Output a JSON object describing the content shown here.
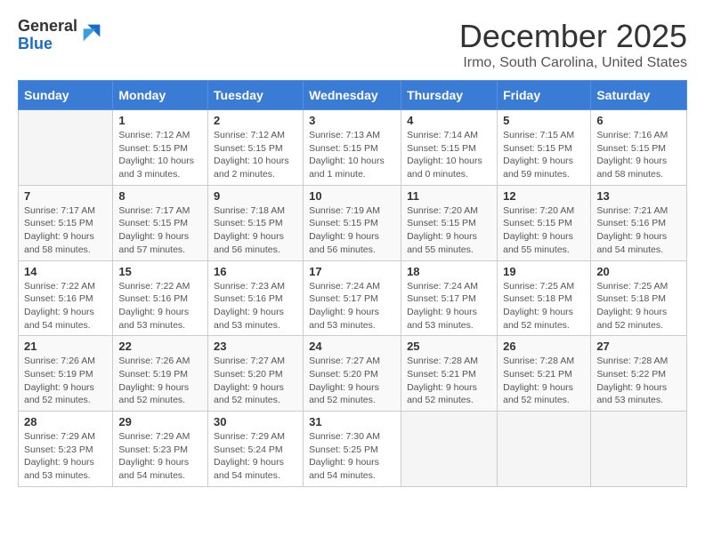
{
  "logo": {
    "general": "General",
    "blue": "Blue"
  },
  "title": "December 2025",
  "subtitle": "Irmo, South Carolina, United States",
  "headers": [
    "Sunday",
    "Monday",
    "Tuesday",
    "Wednesday",
    "Thursday",
    "Friday",
    "Saturday"
  ],
  "weeks": [
    [
      {
        "day": "",
        "info": ""
      },
      {
        "day": "1",
        "info": "Sunrise: 7:12 AM\nSunset: 5:15 PM\nDaylight: 10 hours\nand 3 minutes."
      },
      {
        "day": "2",
        "info": "Sunrise: 7:12 AM\nSunset: 5:15 PM\nDaylight: 10 hours\nand 2 minutes."
      },
      {
        "day": "3",
        "info": "Sunrise: 7:13 AM\nSunset: 5:15 PM\nDaylight: 10 hours\nand 1 minute."
      },
      {
        "day": "4",
        "info": "Sunrise: 7:14 AM\nSunset: 5:15 PM\nDaylight: 10 hours\nand 0 minutes."
      },
      {
        "day": "5",
        "info": "Sunrise: 7:15 AM\nSunset: 5:15 PM\nDaylight: 9 hours\nand 59 minutes."
      },
      {
        "day": "6",
        "info": "Sunrise: 7:16 AM\nSunset: 5:15 PM\nDaylight: 9 hours\nand 58 minutes."
      }
    ],
    [
      {
        "day": "7",
        "info": "Sunrise: 7:17 AM\nSunset: 5:15 PM\nDaylight: 9 hours\nand 58 minutes."
      },
      {
        "day": "8",
        "info": "Sunrise: 7:17 AM\nSunset: 5:15 PM\nDaylight: 9 hours\nand 57 minutes."
      },
      {
        "day": "9",
        "info": "Sunrise: 7:18 AM\nSunset: 5:15 PM\nDaylight: 9 hours\nand 56 minutes."
      },
      {
        "day": "10",
        "info": "Sunrise: 7:19 AM\nSunset: 5:15 PM\nDaylight: 9 hours\nand 56 minutes."
      },
      {
        "day": "11",
        "info": "Sunrise: 7:20 AM\nSunset: 5:15 PM\nDaylight: 9 hours\nand 55 minutes."
      },
      {
        "day": "12",
        "info": "Sunrise: 7:20 AM\nSunset: 5:15 PM\nDaylight: 9 hours\nand 55 minutes."
      },
      {
        "day": "13",
        "info": "Sunrise: 7:21 AM\nSunset: 5:16 PM\nDaylight: 9 hours\nand 54 minutes."
      }
    ],
    [
      {
        "day": "14",
        "info": "Sunrise: 7:22 AM\nSunset: 5:16 PM\nDaylight: 9 hours\nand 54 minutes."
      },
      {
        "day": "15",
        "info": "Sunrise: 7:22 AM\nSunset: 5:16 PM\nDaylight: 9 hours\nand 53 minutes."
      },
      {
        "day": "16",
        "info": "Sunrise: 7:23 AM\nSunset: 5:16 PM\nDaylight: 9 hours\nand 53 minutes."
      },
      {
        "day": "17",
        "info": "Sunrise: 7:24 AM\nSunset: 5:17 PM\nDaylight: 9 hours\nand 53 minutes."
      },
      {
        "day": "18",
        "info": "Sunrise: 7:24 AM\nSunset: 5:17 PM\nDaylight: 9 hours\nand 53 minutes."
      },
      {
        "day": "19",
        "info": "Sunrise: 7:25 AM\nSunset: 5:18 PM\nDaylight: 9 hours\nand 52 minutes."
      },
      {
        "day": "20",
        "info": "Sunrise: 7:25 AM\nSunset: 5:18 PM\nDaylight: 9 hours\nand 52 minutes."
      }
    ],
    [
      {
        "day": "21",
        "info": "Sunrise: 7:26 AM\nSunset: 5:19 PM\nDaylight: 9 hours\nand 52 minutes."
      },
      {
        "day": "22",
        "info": "Sunrise: 7:26 AM\nSunset: 5:19 PM\nDaylight: 9 hours\nand 52 minutes."
      },
      {
        "day": "23",
        "info": "Sunrise: 7:27 AM\nSunset: 5:20 PM\nDaylight: 9 hours\nand 52 minutes."
      },
      {
        "day": "24",
        "info": "Sunrise: 7:27 AM\nSunset: 5:20 PM\nDaylight: 9 hours\nand 52 minutes."
      },
      {
        "day": "25",
        "info": "Sunrise: 7:28 AM\nSunset: 5:21 PM\nDaylight: 9 hours\nand 52 minutes."
      },
      {
        "day": "26",
        "info": "Sunrise: 7:28 AM\nSunset: 5:21 PM\nDaylight: 9 hours\nand 52 minutes."
      },
      {
        "day": "27",
        "info": "Sunrise: 7:28 AM\nSunset: 5:22 PM\nDaylight: 9 hours\nand 53 minutes."
      }
    ],
    [
      {
        "day": "28",
        "info": "Sunrise: 7:29 AM\nSunset: 5:23 PM\nDaylight: 9 hours\nand 53 minutes."
      },
      {
        "day": "29",
        "info": "Sunrise: 7:29 AM\nSunset: 5:23 PM\nDaylight: 9 hours\nand 54 minutes."
      },
      {
        "day": "30",
        "info": "Sunrise: 7:29 AM\nSunset: 5:24 PM\nDaylight: 9 hours\nand 54 minutes."
      },
      {
        "day": "31",
        "info": "Sunrise: 7:30 AM\nSunset: 5:25 PM\nDaylight: 9 hours\nand 54 minutes."
      },
      {
        "day": "",
        "info": ""
      },
      {
        "day": "",
        "info": ""
      },
      {
        "day": "",
        "info": ""
      }
    ]
  ]
}
